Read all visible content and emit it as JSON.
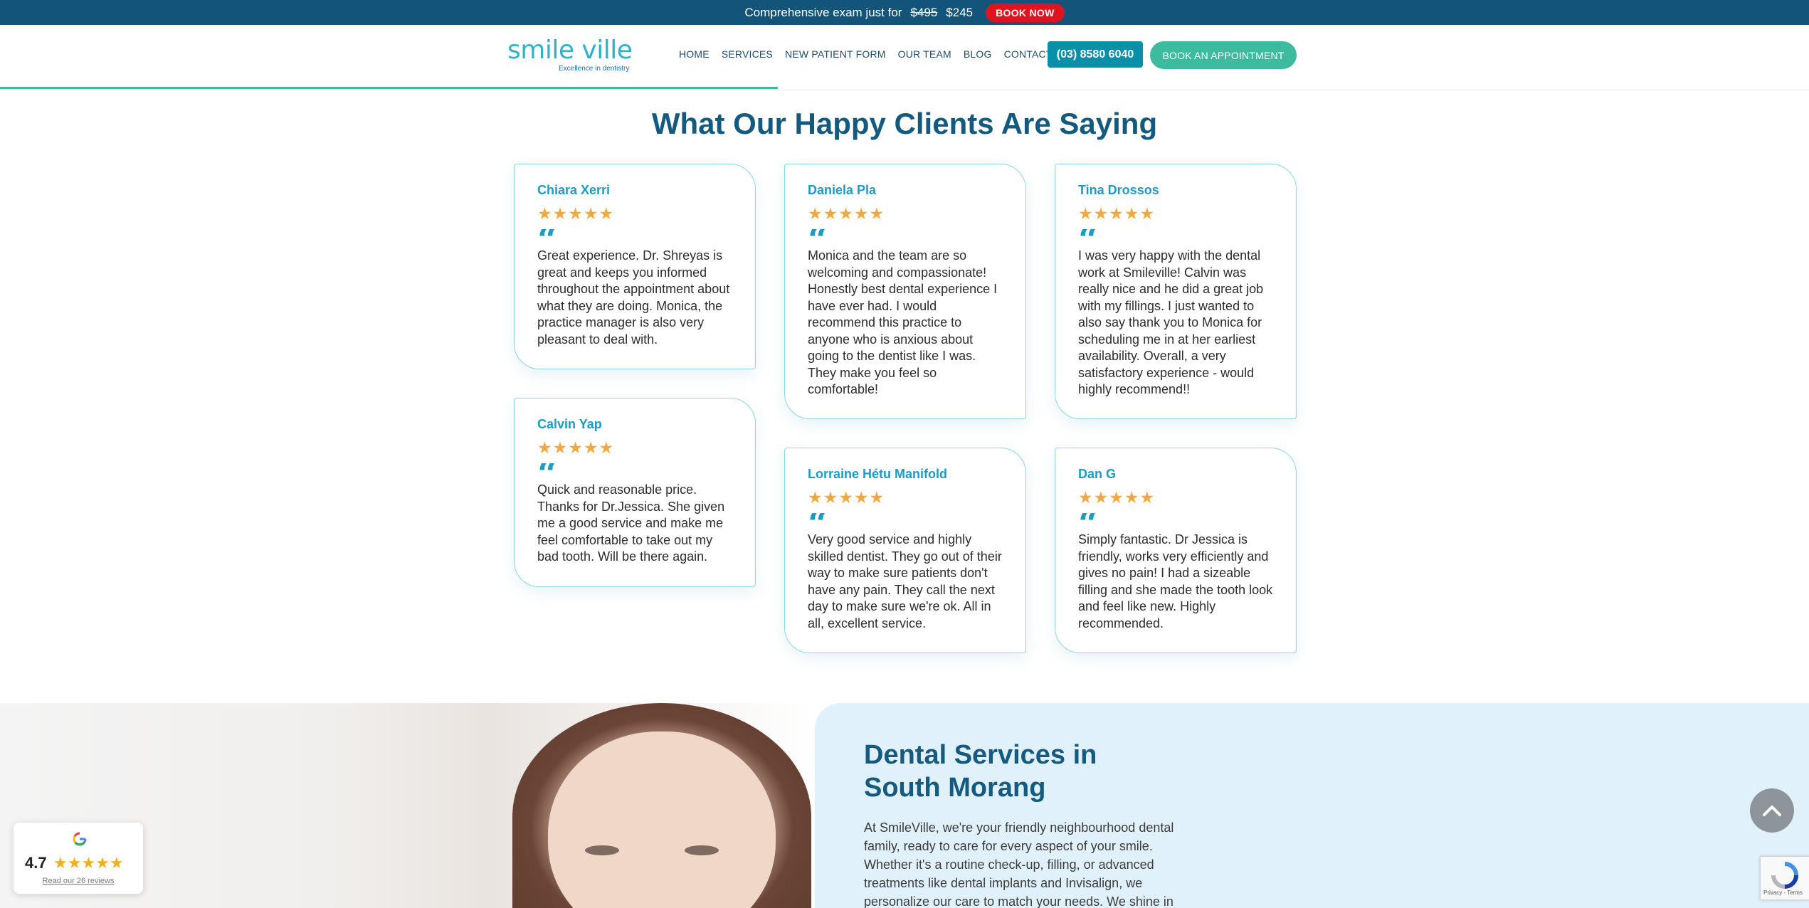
{
  "promo": {
    "text": "Comprehensive exam just for",
    "old_price": "$495",
    "new_price": "$245",
    "cta": "BOOK NOW"
  },
  "header": {
    "logo_text": "smile ville",
    "logo_tagline": "Excellence in dentistry",
    "nav": [
      "HOME",
      "SERVICES",
      "NEW PATIENT FORM",
      "OUR TEAM",
      "BLOG",
      "CONTACT US"
    ],
    "phone": "(03) 8580 6040",
    "appointment": "BOOK AN APPOINTMENT",
    "scroll_progress": 0.43
  },
  "testimonials": {
    "title": "What Our Happy Clients Are Saying",
    "reviews": [
      {
        "name": "Chiara Xerri",
        "stars": "★★★★★",
        "text": "Great experience. Dr. Shreyas is great and keeps you informed throughout the appointment about what they are doing. Monica, the practice manager is also very pleasant to deal with."
      },
      {
        "name": "Daniela Pla",
        "stars": "★★★★★",
        "text": "Monica and the team are so welcoming and compassionate! Honestly best dental experience I have ever had. I would recommend this practice to anyone who is anxious about going to the dentist like I was. They make you feel so comfortable!"
      },
      {
        "name": "Tina Drossos",
        "stars": "★★★★★",
        "text": "I was very happy with the dental work at Smileville! Calvin was really nice and he did a great job with my fillings. I just wanted to also say thank you to Monica for scheduling me in at her earliest availability. Overall, a very satisfactory experience - would highly recommend!!"
      },
      {
        "name": "Calvin Yap",
        "stars": "★★★★★",
        "text": "Quick and reasonable price. Thanks for Dr.Jessica. She given me a good service and make me feel comfortable to take out my bad tooth. Will be there again."
      },
      {
        "name": "Lorraine Hétu Manifold",
        "stars": "★★★★★",
        "text": "Very good service and highly skilled dentist. They go out of their way to make sure patients don't have any pain. They call the next day to make sure we're ok. All in all, excellent service."
      },
      {
        "name": "Dan G",
        "stars": "★★★★★",
        "text": "Simply fantastic. Dr Jessica is friendly, works very efficiently and gives no pain! I had a sizeable filling and she made the tooth look and feel like new. Highly recommended."
      }
    ]
  },
  "services": {
    "heading": "Dental Services in South Morang",
    "body": "At SmileVille, we're your friendly neighbourhood dental family, ready to care for every aspect of your smile. Whether it's a routine check-up, filling, or advanced treatments like dental implants and Invisalign, we personalize our care to match your needs. We shine in"
  },
  "rating_widget": {
    "score": "4.7",
    "stars": "★★★★★",
    "link": "Read our 26 reviews"
  },
  "recaptcha": {
    "text": "Privacy - Terms"
  },
  "colors": {
    "promo_bg": "#13557a",
    "book_now": "#e0141e",
    "accent_teal": "#3dbb9f",
    "phone_bg": "#0a8fa8",
    "title_blue": "#145a7f",
    "name_blue": "#1b9cc6",
    "star_orange": "#f0a940",
    "panel_blue": "#e1f1fb"
  }
}
